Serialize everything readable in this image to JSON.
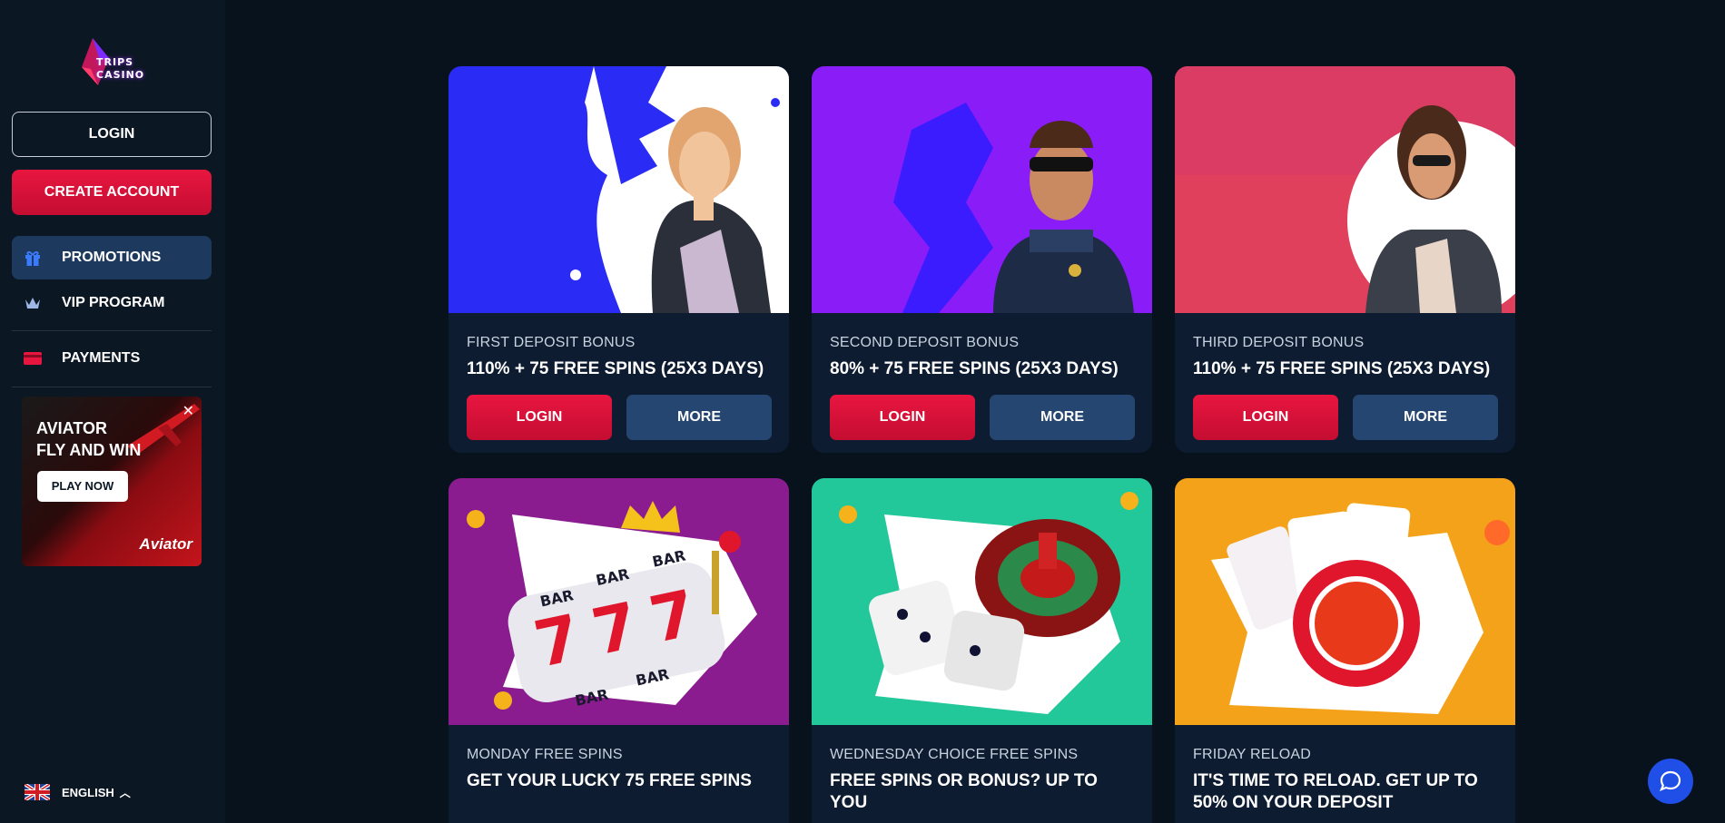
{
  "brand": {
    "logo_line1": "TRIPS",
    "logo_line2": "CASINO"
  },
  "sidebar": {
    "login_label": "LOGIN",
    "create_label": "CREATE ACCOUNT",
    "items": [
      {
        "label": "PROMOTIONS",
        "icon": "gift-icon"
      },
      {
        "label": "VIP PROGRAM",
        "icon": "crown-icon"
      },
      {
        "label": "PAYMENTS",
        "icon": "card-icon"
      }
    ],
    "banner": {
      "title_line1": "AVIATOR",
      "title_line2": "FLY AND WIN",
      "cta": "PLAY NOW",
      "close": "✕",
      "brand": "Aviator"
    },
    "language": "ENGLISH"
  },
  "colors": {
    "accent_red": "#e8163f",
    "more_blue": "#244670",
    "active_nav": "#1d3a5e",
    "page_bg": "#08121d"
  },
  "cards": [
    {
      "title": "FIRST DEPOSIT BONUS",
      "subtitle": "110% + 75 FREE SPINS (25X3 DAYS)",
      "login": "LOGIN",
      "more": "MORE"
    },
    {
      "title": "SECOND DEPOSIT BONUS",
      "subtitle": "80% + 75 FREE SPINS (25X3 DAYS)",
      "login": "LOGIN",
      "more": "MORE"
    },
    {
      "title": "THIRD DEPOSIT BONUS",
      "subtitle": "110% + 75 FREE SPINS (25X3 DAYS)",
      "login": "LOGIN",
      "more": "MORE"
    },
    {
      "title": "MONDAY FREE SPINS",
      "subtitle": "GET YOUR LUCKY 75 FREE SPINS"
    },
    {
      "title": "WEDNESDAY CHOICE FREE SPINS",
      "subtitle": "FREE SPINS OR BONUS? UP TO YOU"
    },
    {
      "title": "FRIDAY RELOAD",
      "subtitle": "IT'S TIME TO RELOAD. GET UP TO 50% ON YOUR DEPOSIT"
    }
  ],
  "slot_reel_labels": [
    "BAR",
    "BAR",
    "BAR",
    "BAR",
    "BAR"
  ]
}
